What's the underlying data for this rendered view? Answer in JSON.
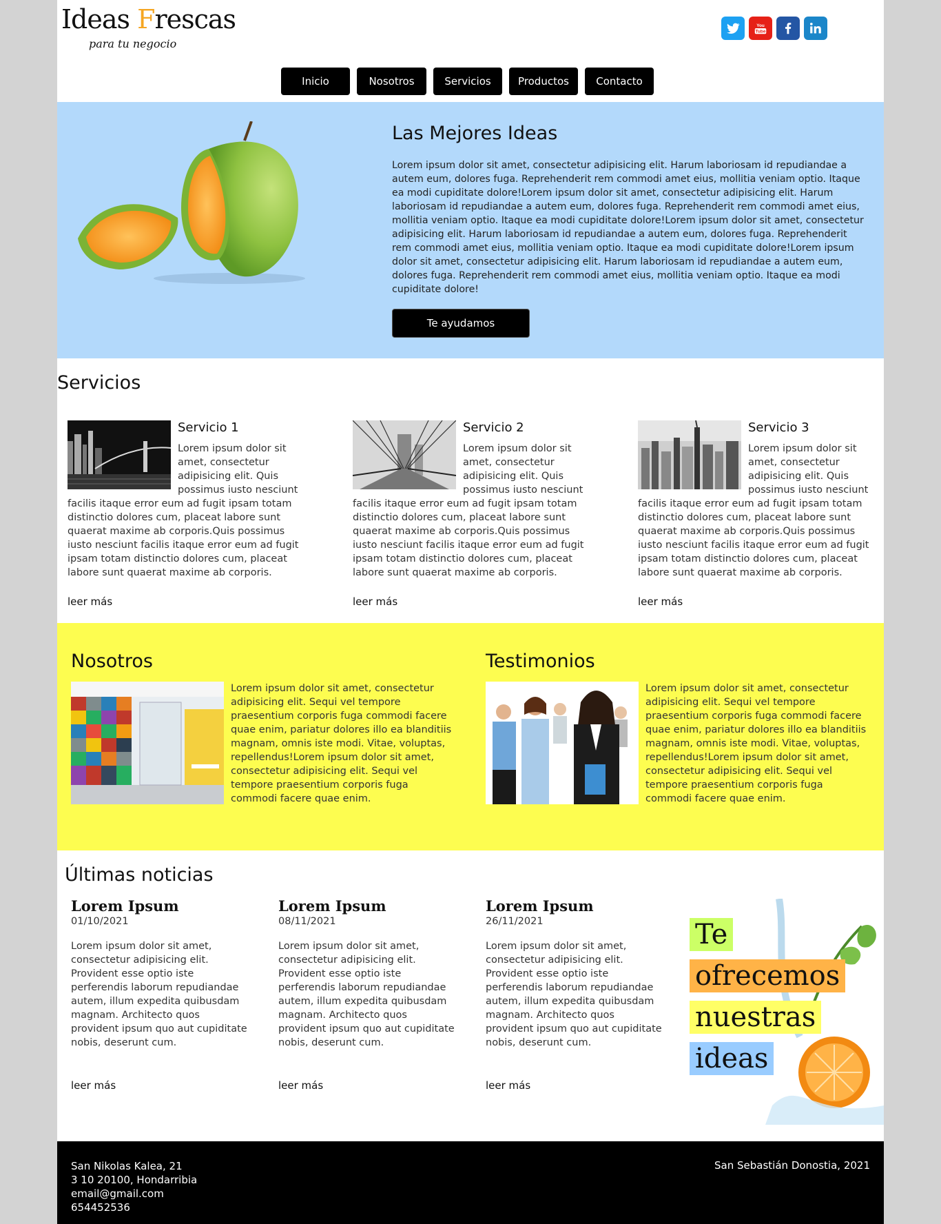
{
  "header": {
    "logo_part1": "Ideas ",
    "logo_accent": "F",
    "logo_part2": "rescas",
    "tagline": "para tu negocio",
    "social": [
      "twitter-icon",
      "youtube-icon",
      "facebook-icon",
      "linkedin-icon"
    ],
    "social_colors": {
      "twitter": "#1da1f2",
      "youtube": "#e62117",
      "facebook": "#2456a4",
      "linkedin": "#1b86c9"
    },
    "nav": [
      {
        "label": "Inicio",
        "w": 100
      },
      {
        "label": "Nosotros"
      },
      {
        "label": "Servicios"
      },
      {
        "label": "Productos"
      },
      {
        "label": "Contacto"
      }
    ]
  },
  "hero": {
    "title": "Las Mejores Ideas",
    "text": "Lorem ipsum dolor sit amet, consectetur adipisicing elit. Harum laboriosam id repudiandae a autem eum, dolores fuga. Reprehenderit rem commodi amet eius, mollitia veniam optio. Itaque ea modi cupiditate dolore!Lorem ipsum dolor sit amet, consectetur adipisicing elit. Harum laboriosam id repudiandae a autem eum, dolores fuga. Reprehenderit rem commodi amet eius, mollitia veniam optio. Itaque ea modi cupiditate dolore!Lorem ipsum dolor sit amet, consectetur adipisicing elit. Harum laboriosam id repudiandae a autem eum, dolores fuga. Reprehenderit rem commodi amet eius, mollitia veniam optio. Itaque ea modi cupiditate dolore!Lorem ipsum dolor sit amet, consectetur adipisicing elit. Harum laboriosam id repudiandae a autem eum, dolores fuga. Reprehenderit rem commodi amet eius, mollitia veniam optio. Itaque ea modi cupiditate dolore!",
    "button": "Te ayudamos",
    "bg_color": "#b3d9fb"
  },
  "services": {
    "title": "Servicios",
    "items": [
      {
        "title": "Servicio 1",
        "text": "Lorem ipsum dolor sit amet, consectetur adipisicing elit. Quis possimus iusto nesciunt facilis itaque error eum ad fugit ipsam totam distinctio dolores cum, placeat labore sunt quaerat maxime ab corporis.Quis possimus iusto nesciunt facilis itaque error eum ad fugit ipsam totam distinctio dolores cum, placeat labore sunt quaerat maxime ab corporis.",
        "more": "leer más"
      },
      {
        "title": "Servicio 2",
        "text": "Lorem ipsum dolor sit amet, consectetur adipisicing elit. Quis possimus iusto nesciunt facilis itaque error eum ad fugit ipsam totam distinctio dolores cum, placeat labore sunt quaerat maxime ab corporis.Quis possimus iusto nesciunt facilis itaque error eum ad fugit ipsam totam distinctio dolores cum, placeat labore sunt quaerat maxime ab corporis.",
        "more": "leer más"
      },
      {
        "title": "Servicio 3",
        "text": "Lorem ipsum dolor sit amet, consectetur adipisicing elit. Quis possimus iusto nesciunt facilis itaque error eum ad fugit ipsam totam distinctio dolores cum, placeat labore sunt quaerat maxime ab corporis.Quis possimus iusto nesciunt facilis itaque error eum ad fugit ipsam totam distinctio dolores cum, placeat labore sunt quaerat maxime ab corporis.",
        "more": "leer más"
      }
    ]
  },
  "about": {
    "title": "Nosotros",
    "text": "Lorem ipsum dolor sit amet, consectetur adipisicing elit. Sequi vel tempore praesentium corporis fuga commodi facere quae enim, pariatur dolores illo ea blanditiis magnam, omnis iste modi. Vitae, voluptas, repellendus!Lorem ipsum dolor sit amet, consectetur adipisicing elit. Sequi vel tempore praesentium corporis fuga commodi facere quae enim."
  },
  "testimonials": {
    "title": "Testimonios",
    "text": "Lorem ipsum dolor sit amet, consectetur adipisicing elit. Sequi vel tempore praesentium corporis fuga commodi facere quae enim, pariatur dolores illo ea blanditiis magnam, omnis iste modi. Vitae, voluptas, repellendus!Lorem ipsum dolor sit amet, consectetur adipisicing elit. Sequi vel tempore praesentium corporis fuga commodi facere quae enim."
  },
  "yellow_bg": "#fdfd50",
  "news": {
    "title": "Últimas noticias",
    "items": [
      {
        "title": "Lorem Ipsum",
        "date": "01/10/2021",
        "text": "Lorem ipsum dolor sit amet, consectetur adipisicing elit. Provident esse optio iste perferendis laborum repudiandae autem, illum expedita quibusdam magnam. Architecto quos provident ipsum quo aut cupiditate nobis, deserunt cum.",
        "more": "leer más"
      },
      {
        "title": "Lorem Ipsum",
        "date": "08/11/2021",
        "text": "Lorem ipsum dolor sit amet, consectetur adipisicing elit. Provident esse optio iste perferendis laborum repudiandae autem, illum expedita quibusdam magnam. Architecto quos provident ipsum quo aut cupiditate nobis, deserunt cum.",
        "more": "leer más"
      },
      {
        "title": "Lorem Ipsum",
        "date": "26/11/2021",
        "text": "Lorem ipsum dolor sit amet, consectetur adipisicing elit. Provident esse optio iste perferendis laborum repudiandae autem, illum expedita quibusdam magnam. Architecto quos provident ipsum quo aut cupiditate nobis, deserunt cum.",
        "more": "leer más"
      }
    ],
    "promo_words": [
      "Te",
      "ofrecemos",
      "nuestras",
      "ideas"
    ]
  },
  "footer": {
    "address_line1": "San Nikolas Kalea, 21",
    "address_line2": "3 10 20100, Hondarribia",
    "email": "email@gmail.com",
    "phone": "654452536",
    "copyright": "San Sebastián Donostia, 2021"
  }
}
